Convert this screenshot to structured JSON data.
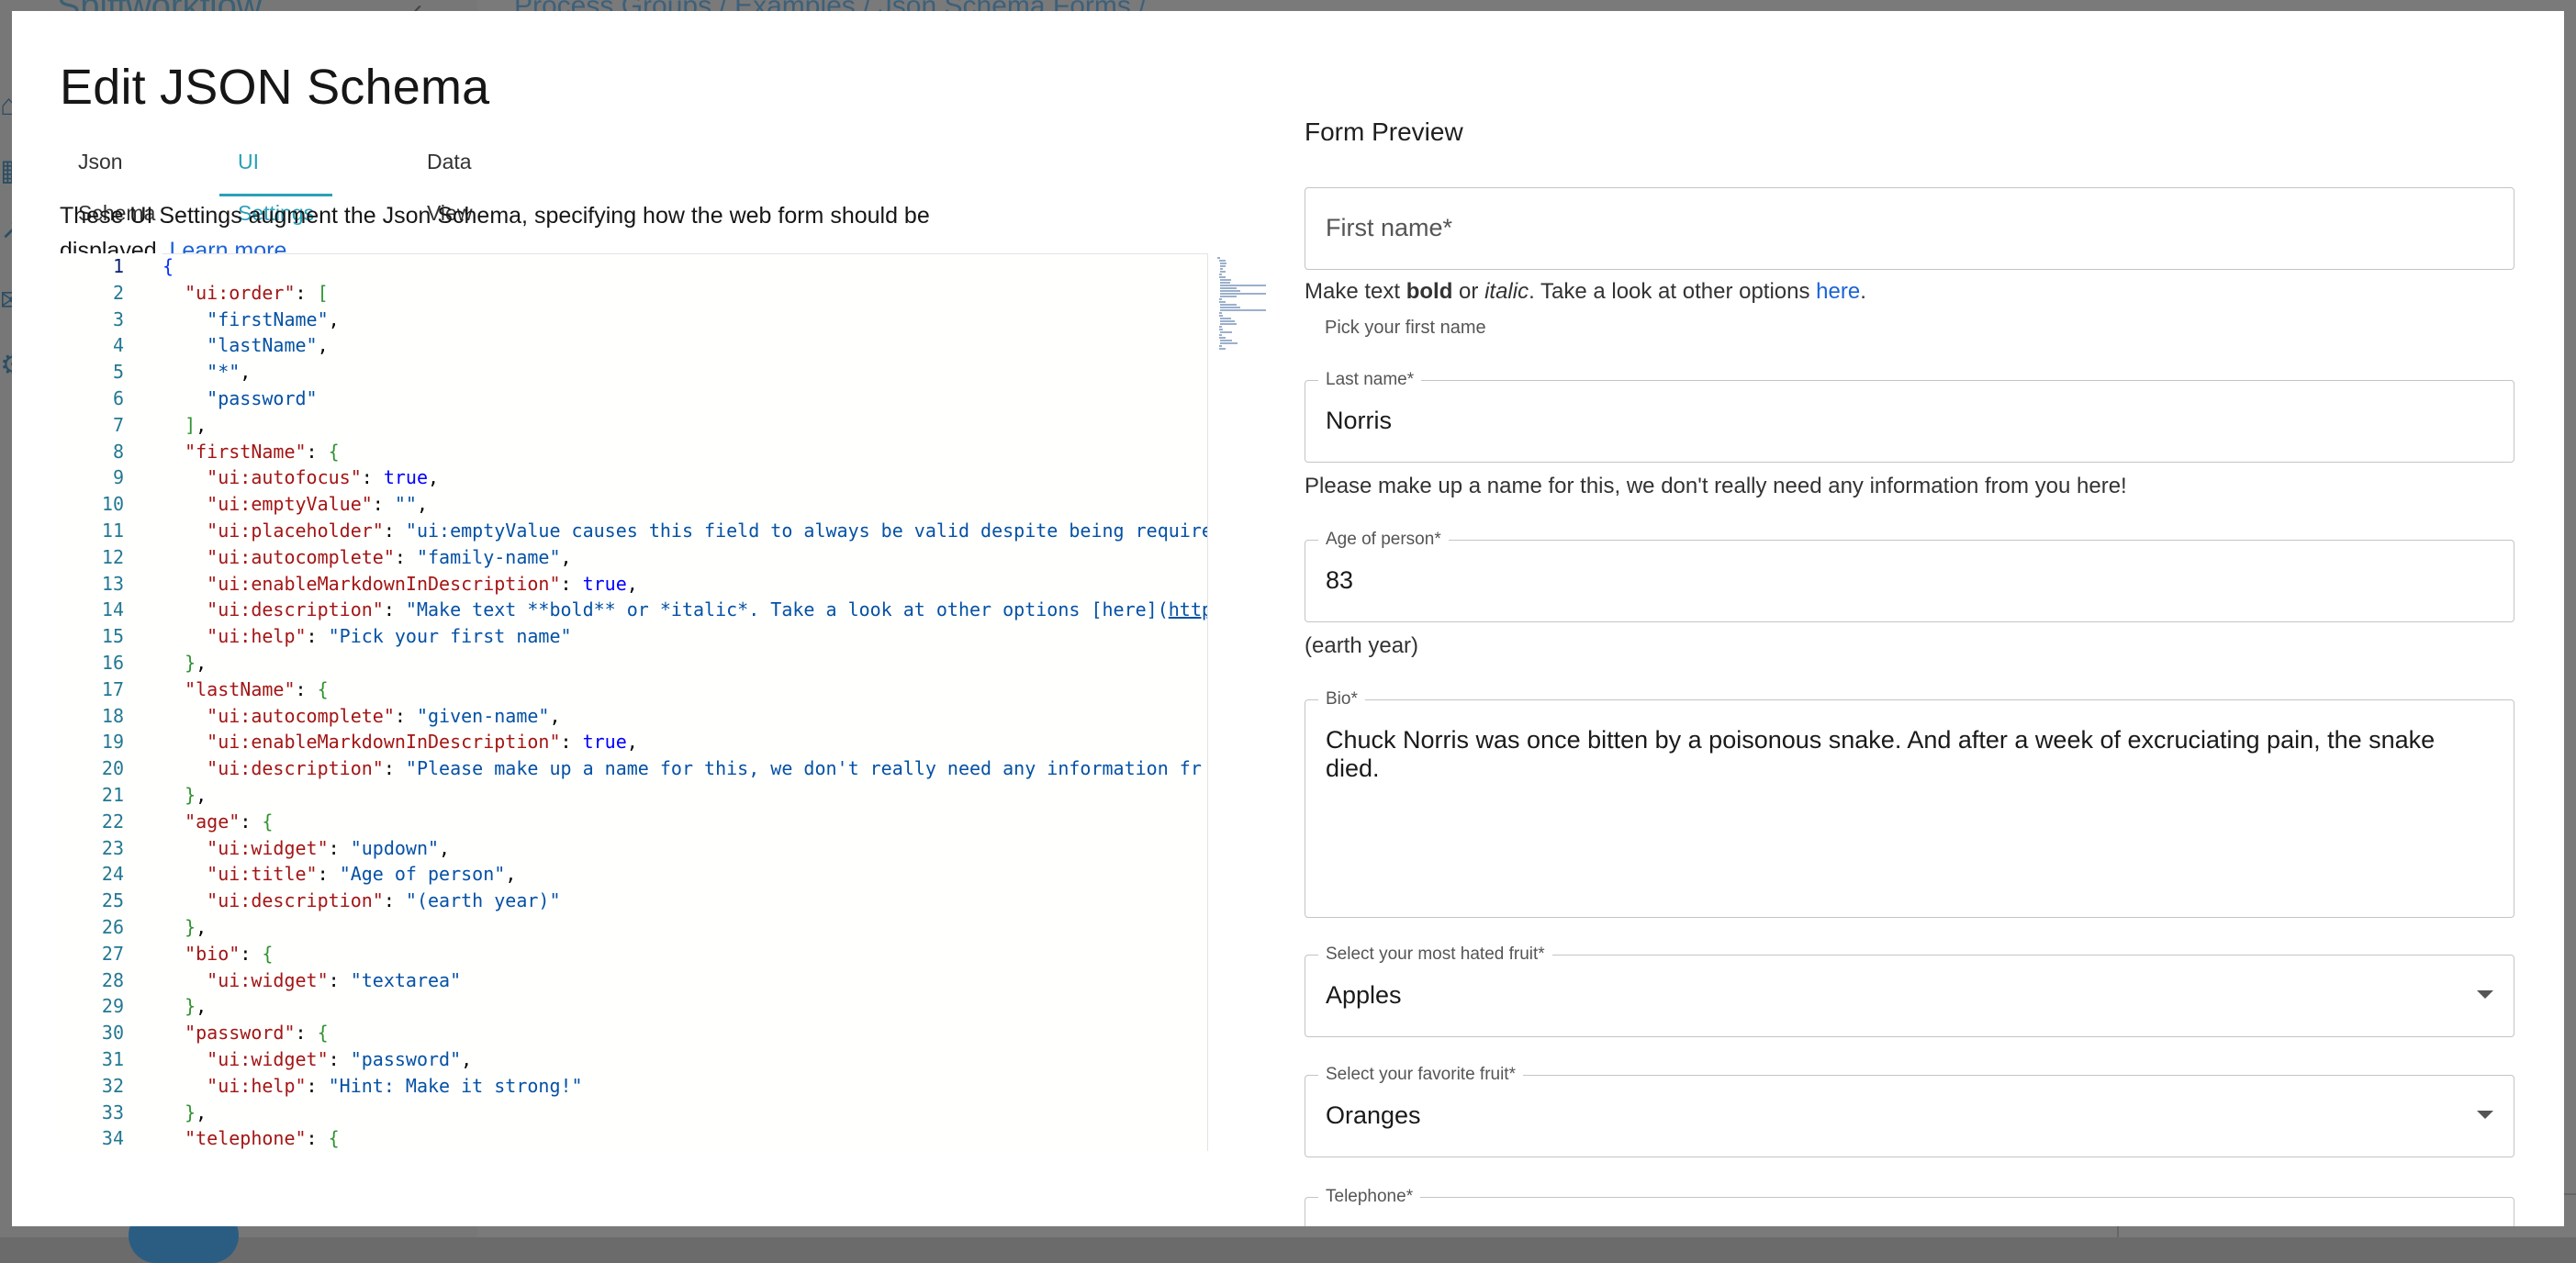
{
  "background": {
    "brand": "Spiffworkflow",
    "breadcrumb": "Process Groups / Examples / Json Schema Forms / ..."
  },
  "modal": {
    "title": "Edit JSON Schema",
    "tabs": [
      {
        "label": "Json Schema",
        "active": false
      },
      {
        "label": "UI Settings",
        "active": true
      },
      {
        "label": "Data View",
        "active": false
      }
    ],
    "intro_text": "These UI Settings augment the Json Schema, specifying how the web form should be displayed.",
    "learn_more": "Learn more",
    "intro_end": "."
  },
  "editor": {
    "language": "json",
    "current_line": 1,
    "line_numbers": [
      "1",
      "2",
      "3",
      "4",
      "5",
      "6",
      "7",
      "8",
      "9",
      "10",
      "11",
      "12",
      "13",
      "14",
      "15",
      "16",
      "17",
      "18",
      "19",
      "20",
      "21",
      "22",
      "23",
      "24",
      "25",
      "26",
      "27",
      "28",
      "29",
      "30",
      "31",
      "32",
      "33",
      "34"
    ],
    "code_lines": [
      "{",
      "  \"ui:order\": [",
      "    \"firstName\",",
      "    \"lastName\",",
      "    \"*\",",
      "    \"password\"",
      "  ],",
      "  \"firstName\": {",
      "    \"ui:autofocus\": true,",
      "    \"ui:emptyValue\": \"\",",
      "    \"ui:placeholder\": \"ui:emptyValue causes this field to always be valid despite being required",
      "    \"ui:autocomplete\": \"family-name\",",
      "    \"ui:enableMarkdownInDescription\": true,",
      "    \"ui:description\": \"Make text **bold** or *italic*. Take a look at other options [here](http",
      "    \"ui:help\": \"Pick your first name\"",
      "  },",
      "  \"lastName\": {",
      "    \"ui:autocomplete\": \"given-name\",",
      "    \"ui:enableMarkdownInDescription\": true,",
      "    \"ui:description\": \"Please make up a name for this, we don't really need any information fr",
      "  },",
      "  \"age\": {",
      "    \"ui:widget\": \"updown\",",
      "    \"ui:title\": \"Age of person\",",
      "    \"ui:description\": \"(earth year)\"",
      "  },",
      "  \"bio\": {",
      "    \"ui:widget\": \"textarea\"",
      "  },",
      "  \"password\": {",
      "    \"ui:widget\": \"password\",",
      "    \"ui:help\": \"Hint: Make it strong!\"",
      "  },",
      "  \"telephone\": {"
    ]
  },
  "preview": {
    "title": "Form Preview",
    "first_name": {
      "label": "First name",
      "required_mark": "*",
      "description_pre": "Make text ",
      "description_bold": "bold",
      "description_mid": " or ",
      "description_italic": "italic",
      "description_post": ". Take a look at other options ",
      "description_link": "here",
      "description_end": ".",
      "help": "Pick your first name"
    },
    "last_name": {
      "label": "Last name",
      "required_mark": "*",
      "value": "Norris",
      "description": "Please make up a name for this, we don't really need any information from you here!"
    },
    "age": {
      "label": "Age of person",
      "required_mark": "*",
      "value": "83",
      "description": "(earth year)"
    },
    "bio": {
      "label": "Bio",
      "required_mark": "*",
      "value": "Chuck Norris was once bitten by a poisonous snake. And after a week of excruciating pain, the snake died."
    },
    "hated_fruit": {
      "label": "Select your most hated fruit",
      "required_mark": "*",
      "value": "Apples"
    },
    "favorite_fruit": {
      "label": "Select your favorite fruit",
      "required_mark": "*",
      "value": "Oranges"
    },
    "telephone": {
      "label": "Telephone",
      "required_mark": "*"
    }
  },
  "colors": {
    "accent": "#2aa0b8",
    "link": "#1c63d6"
  }
}
